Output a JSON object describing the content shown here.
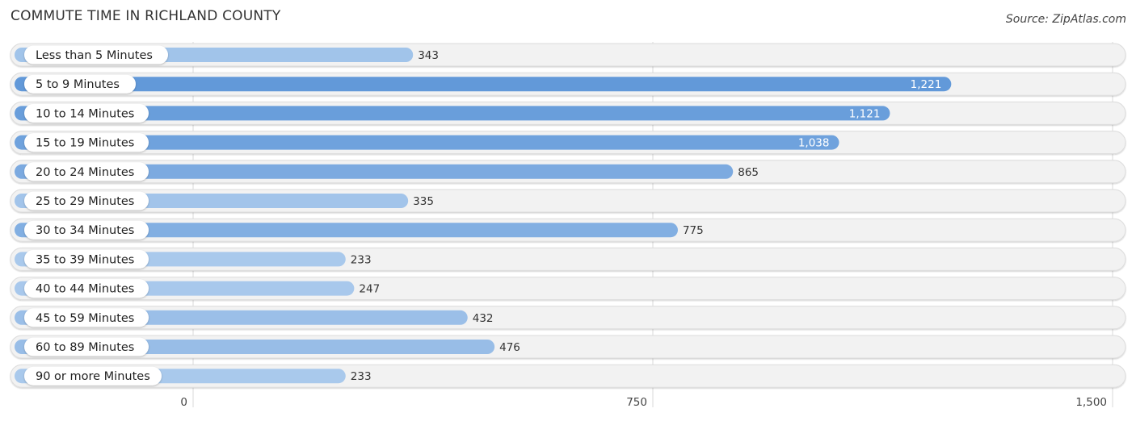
{
  "header": {
    "title": "COMMUTE TIME IN RICHLAND COUNTY",
    "source": "Source: ZipAtlas.com"
  },
  "colors": {
    "bar_low": "#a9c9ec",
    "bar_high": "#6299d9",
    "track": "#f2f2f2",
    "track_border": "#dcdcdc",
    "grid": "#d8d8d8",
    "value_inside": "#ffffff",
    "value_outside": "#333333"
  },
  "chart_data": {
    "type": "bar",
    "orientation": "horizontal",
    "title": "COMMUTE TIME IN RICHLAND COUNTY",
    "xlabel": "",
    "ylabel": "",
    "categories": [
      "Less than 5 Minutes",
      "5 to 9 Minutes",
      "10 to 14 Minutes",
      "15 to 19 Minutes",
      "20 to 24 Minutes",
      "25 to 29 Minutes",
      "30 to 34 Minutes",
      "35 to 39 Minutes",
      "40 to 44 Minutes",
      "45 to 59 Minutes",
      "60 to 89 Minutes",
      "90 or more Minutes"
    ],
    "values": [
      343,
      1221,
      1121,
      1038,
      865,
      335,
      775,
      233,
      247,
      432,
      476,
      233
    ],
    "value_labels": [
      "343",
      "1,221",
      "1,121",
      "1,038",
      "865",
      "335",
      "775",
      "233",
      "247",
      "432",
      "476",
      "233"
    ],
    "xlim": [
      0,
      1500
    ],
    "xticks": [
      0,
      750,
      1500
    ],
    "xtick_labels": [
      "0",
      "750",
      "1,500"
    ],
    "grid": true,
    "legend": "none"
  }
}
